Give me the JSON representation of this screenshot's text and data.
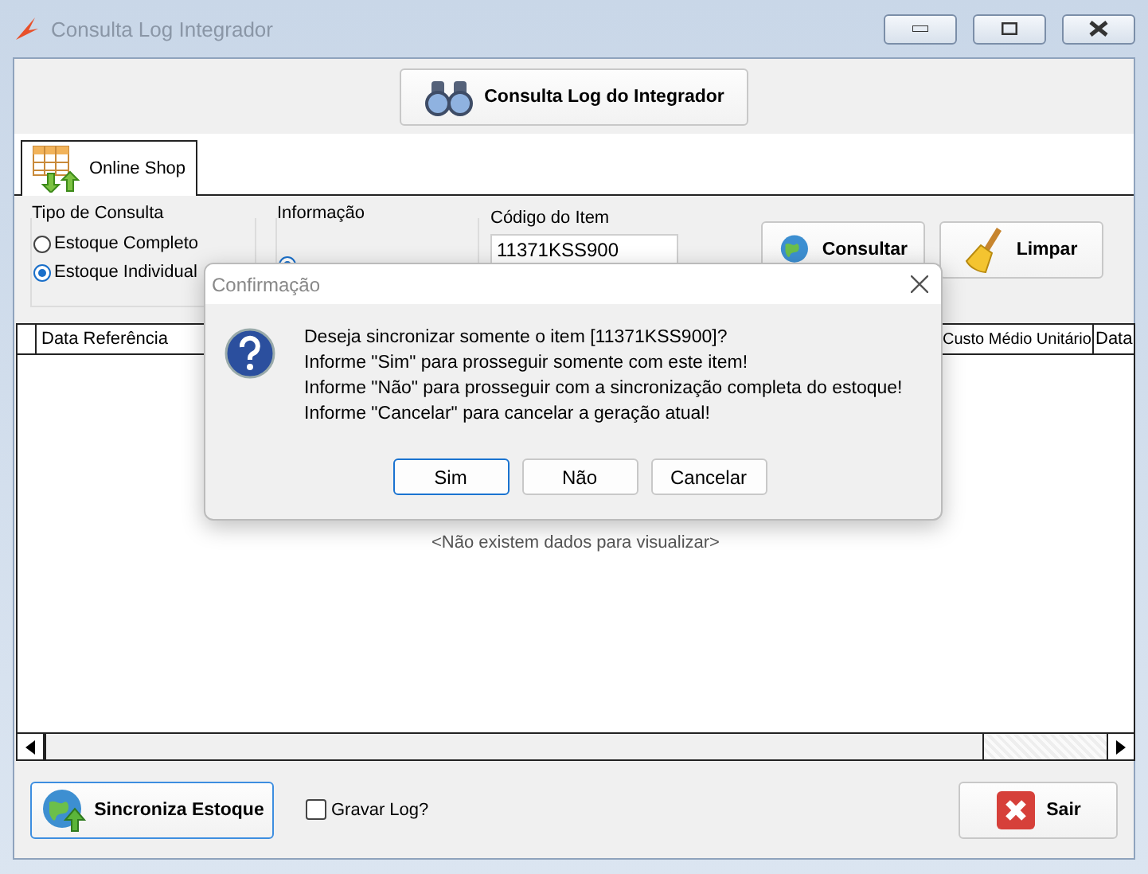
{
  "window": {
    "title": "Consulta Log Integrador"
  },
  "header_button": {
    "label": "Consulta Log do Integrador"
  },
  "tabs": [
    {
      "label": "Online Shop",
      "selected": true
    }
  ],
  "tipo_consulta": {
    "title": "Tipo de Consulta",
    "options": [
      {
        "label": "Estoque Completo",
        "selected": false
      },
      {
        "label": "Estoque Individual",
        "selected": true
      }
    ]
  },
  "informacao": {
    "title": "Informação",
    "options": [
      {
        "selected": true
      }
    ]
  },
  "codigo_item": {
    "label": "Código do Item",
    "value": "11371KSS900"
  },
  "consultar_button": {
    "label": "Consultar"
  },
  "limpar_button": {
    "label": "Limpar"
  },
  "table": {
    "columns": [
      "Data Referência",
      "Custo Médio Unitário",
      "Data"
    ],
    "empty_message": "<Não existem dados para visualizar>"
  },
  "sync_button": {
    "label": "Sincroniza Estoque"
  },
  "gravar_log": {
    "label": "Gravar Log?",
    "checked": false
  },
  "sair_button": {
    "label": "Sair"
  },
  "dialog": {
    "title": "Confirmação",
    "message": "Deseja sincronizar somente o item [11371KSS900]?\nInforme \"Sim\" para prosseguir somente com este item!\nInforme \"Não\" para prosseguir com a sincronização completa do estoque!\nInforme \"Cancelar\" para cancelar a geração atual!",
    "buttons": [
      {
        "label": "Sim",
        "selected": true
      },
      {
        "label": "Não",
        "selected": false
      },
      {
        "label": "Cancelar",
        "selected": false
      }
    ]
  }
}
